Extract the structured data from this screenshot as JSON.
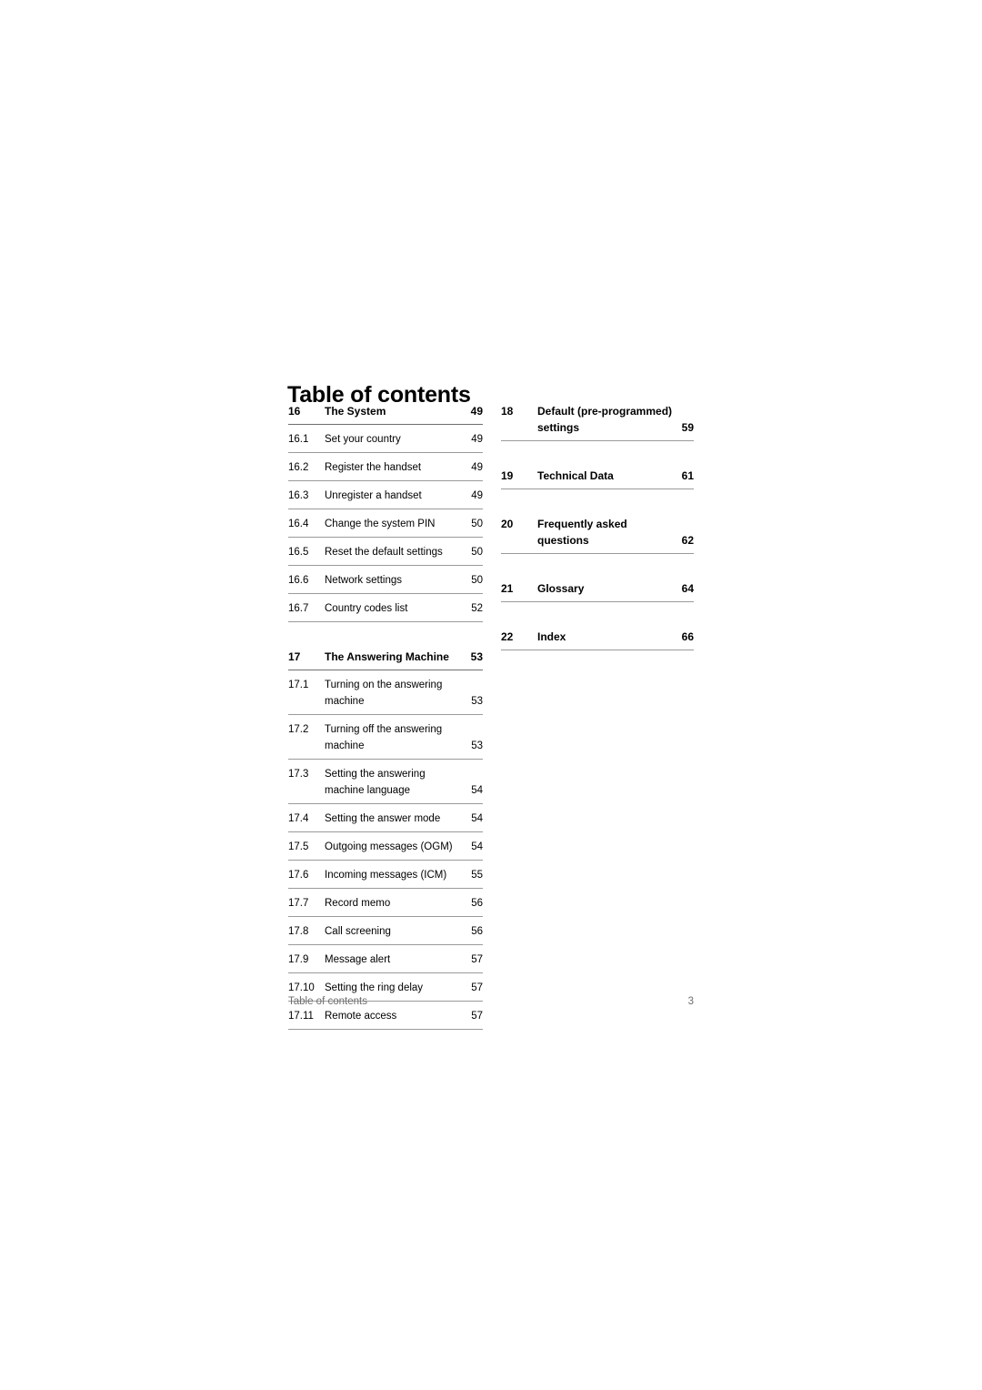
{
  "document": {
    "title": "Table of contents",
    "footer_label": "Table of contents",
    "page_number": "3"
  },
  "colors": {
    "text": "#000000",
    "rule": "#9a9a9a",
    "rule_strong": "#6e6e6e",
    "footer_text": "#6d6d6d",
    "page_background": "#ffffff"
  },
  "columns": {
    "left": {
      "entries": [
        {
          "number": "16",
          "title": "The System",
          "title2": "",
          "page": "49",
          "level": "chapter",
          "rule": "strong",
          "gap_before": false
        },
        {
          "number": "16.1",
          "title": "Set your country",
          "title2": "",
          "page": "49",
          "level": "section",
          "rule": "normal",
          "gap_before": false
        },
        {
          "number": "16.2",
          "title": "Register the handset",
          "title2": "",
          "page": "49",
          "level": "section",
          "rule": "normal",
          "gap_before": false
        },
        {
          "number": "16.3",
          "title": "Unregister a handset",
          "title2": "",
          "page": "49",
          "level": "section",
          "rule": "normal",
          "gap_before": false
        },
        {
          "number": "16.4",
          "title": "Change the system PIN",
          "title2": "",
          "page": "50",
          "level": "section",
          "rule": "normal",
          "gap_before": false
        },
        {
          "number": "16.5",
          "title": "Reset the default settings",
          "title2": "",
          "page": "50",
          "level": "section",
          "rule": "normal",
          "gap_before": false
        },
        {
          "number": "16.6",
          "title": "Network settings",
          "title2": "",
          "page": "50",
          "level": "section",
          "rule": "normal",
          "gap_before": false
        },
        {
          "number": "16.7",
          "title": "Country codes list",
          "title2": "",
          "page": "52",
          "level": "section",
          "rule": "normal",
          "gap_before": false
        },
        {
          "number": "17",
          "title": "The Answering Machine",
          "title2": "",
          "page": "53",
          "level": "chapter",
          "rule": "strong",
          "gap_before": true
        },
        {
          "number": "17.1",
          "title": "Turning on the answering",
          "title2": "machine",
          "page": "53",
          "level": "section",
          "rule": "normal",
          "gap_before": false
        },
        {
          "number": "17.2",
          "title": "Turning off the answering",
          "title2": "machine",
          "page": "53",
          "level": "section",
          "rule": "normal",
          "gap_before": false
        },
        {
          "number": "17.3",
          "title": "Setting the answering",
          "title2": "machine language",
          "page": "54",
          "level": "section",
          "rule": "normal",
          "gap_before": false
        },
        {
          "number": "17.4",
          "title": "Setting the answer mode",
          "title2": "",
          "page": "54",
          "level": "section",
          "rule": "normal",
          "gap_before": false
        },
        {
          "number": "17.5",
          "title": "Outgoing messages (OGM)",
          "title2": "",
          "page": "54",
          "level": "section",
          "rule": "normal",
          "gap_before": false
        },
        {
          "number": "17.6",
          "title": "Incoming messages (ICM)",
          "title2": "",
          "page": "55",
          "level": "section",
          "rule": "normal",
          "gap_before": false
        },
        {
          "number": "17.7",
          "title": "Record memo",
          "title2": "",
          "page": "56",
          "level": "section",
          "rule": "normal",
          "gap_before": false
        },
        {
          "number": "17.8",
          "title": "Call screening",
          "title2": "",
          "page": "56",
          "level": "section",
          "rule": "normal",
          "gap_before": false
        },
        {
          "number": "17.9",
          "title": "Message alert",
          "title2": "",
          "page": "57",
          "level": "section",
          "rule": "normal",
          "gap_before": false
        },
        {
          "number": "17.10",
          "title": "Setting the ring delay",
          "title2": "",
          "page": "57",
          "level": "section",
          "rule": "normal",
          "gap_before": false
        },
        {
          "number": "17.11",
          "title": "Remote access",
          "title2": "",
          "page": "57",
          "level": "section",
          "rule": "normal",
          "gap_before": false
        }
      ]
    },
    "right": {
      "entries": [
        {
          "number": "18",
          "title": "Default (pre-programmed)",
          "title2": "settings",
          "page": "59",
          "level": "chapter",
          "rule": "normal",
          "gap_before": false
        },
        {
          "number": "19",
          "title": "Technical Data",
          "title2": "",
          "page": "61",
          "level": "chapter",
          "rule": "normal",
          "gap_before": true
        },
        {
          "number": "20",
          "title": "Frequently asked",
          "title2": "questions",
          "page": "62",
          "level": "chapter",
          "rule": "normal",
          "gap_before": true
        },
        {
          "number": "21",
          "title": "Glossary",
          "title2": "",
          "page": "64",
          "level": "chapter",
          "rule": "normal",
          "gap_before": true
        },
        {
          "number": "22",
          "title": "Index",
          "title2": "",
          "page": "66",
          "level": "chapter",
          "rule": "normal",
          "gap_before": true
        }
      ]
    }
  }
}
